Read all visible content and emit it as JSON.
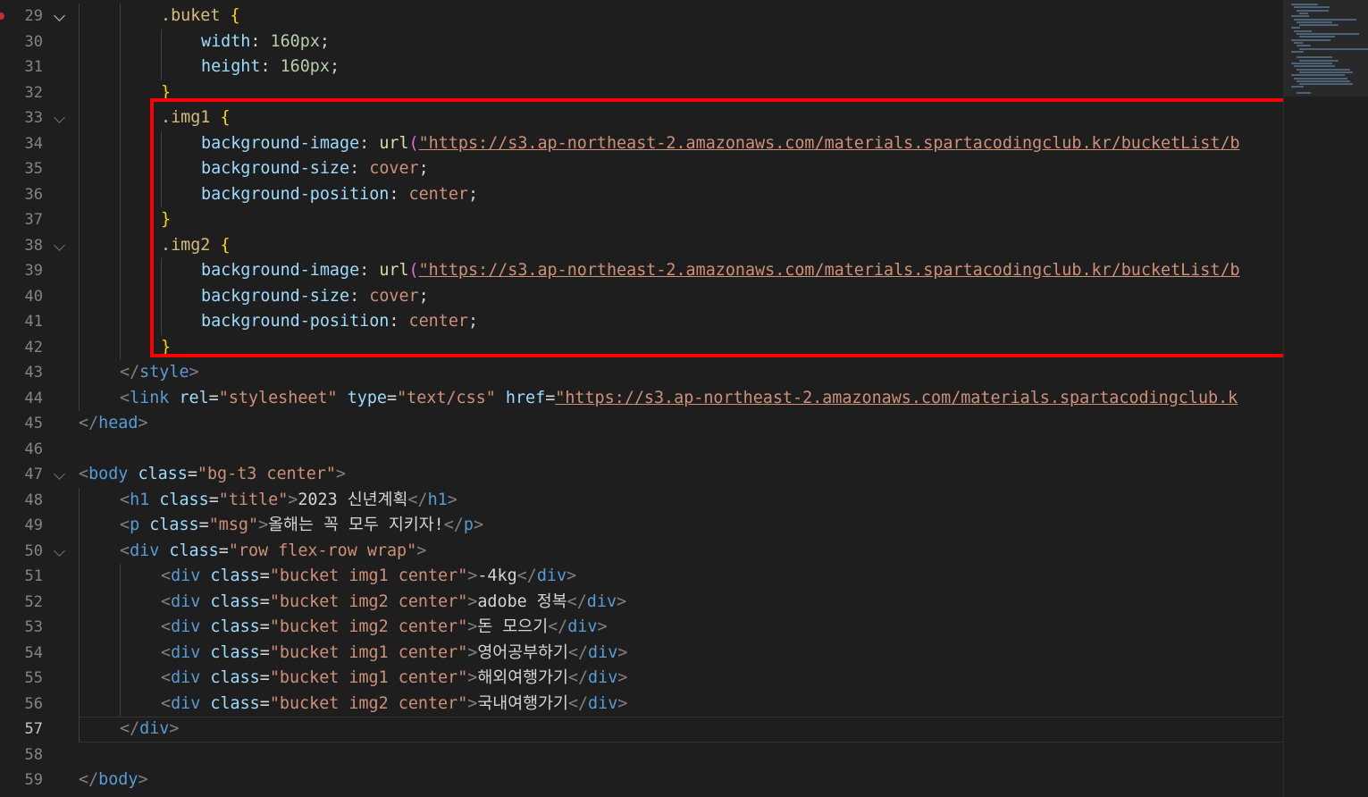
{
  "editor": {
    "current_line": 57,
    "lines": [
      {
        "num": "29",
        "tokens": [
          [
            "t-sel",
            ".buket "
          ],
          [
            "t-br",
            "{"
          ]
        ]
      },
      {
        "num": "30",
        "tokens": [
          [
            "t-prop",
            "width"
          ],
          [
            "t-punc",
            ": "
          ],
          [
            "t-num",
            "160px"
          ],
          [
            "t-punc",
            ";"
          ]
        ]
      },
      {
        "num": "31",
        "tokens": [
          [
            "t-prop",
            "height"
          ],
          [
            "t-punc",
            ": "
          ],
          [
            "t-num",
            "160px"
          ],
          [
            "t-punc",
            ";"
          ]
        ]
      },
      {
        "num": "32",
        "tokens": [
          [
            "t-br",
            "}"
          ]
        ]
      },
      {
        "num": "33",
        "tokens": [
          [
            "t-sel",
            ".img1 "
          ],
          [
            "t-br",
            "{"
          ]
        ]
      },
      {
        "num": "34",
        "tokens": [
          [
            "t-prop",
            "background-image"
          ],
          [
            "t-punc",
            ": "
          ],
          [
            "t-fn",
            "url"
          ],
          [
            "t-br2",
            "("
          ],
          [
            "t-url",
            "\"https://s3.ap-northeast-2.amazonaws.com/materials.spartacodingclub.kr/bucketList/b"
          ]
        ]
      },
      {
        "num": "35",
        "tokens": [
          [
            "t-prop",
            "background-size"
          ],
          [
            "t-punc",
            ": "
          ],
          [
            "t-val",
            "cover"
          ],
          [
            "t-punc",
            ";"
          ]
        ]
      },
      {
        "num": "36",
        "tokens": [
          [
            "t-prop",
            "background-position"
          ],
          [
            "t-punc",
            ": "
          ],
          [
            "t-val",
            "center"
          ],
          [
            "t-punc",
            ";"
          ]
        ]
      },
      {
        "num": "37",
        "tokens": [
          [
            "t-br",
            "}"
          ]
        ]
      },
      {
        "num": "38",
        "tokens": [
          [
            "t-sel",
            ".img2 "
          ],
          [
            "t-br",
            "{"
          ]
        ]
      },
      {
        "num": "39",
        "tokens": [
          [
            "t-prop",
            "background-image"
          ],
          [
            "t-punc",
            ": "
          ],
          [
            "t-fn",
            "url"
          ],
          [
            "t-br2",
            "("
          ],
          [
            "t-url",
            "\"https://s3.ap-northeast-2.amazonaws.com/materials.spartacodingclub.kr/bucketList/b"
          ]
        ]
      },
      {
        "num": "40",
        "tokens": [
          [
            "t-prop",
            "background-size"
          ],
          [
            "t-punc",
            ": "
          ],
          [
            "t-val",
            "cover"
          ],
          [
            "t-punc",
            ";"
          ]
        ]
      },
      {
        "num": "41",
        "tokens": [
          [
            "t-prop",
            "background-position"
          ],
          [
            "t-punc",
            ": "
          ],
          [
            "t-val",
            "center"
          ],
          [
            "t-punc",
            ";"
          ]
        ]
      },
      {
        "num": "42",
        "tokens": [
          [
            "t-br",
            "}"
          ]
        ]
      },
      {
        "num": "43",
        "tokens": [
          [
            "t-tagp",
            "</"
          ],
          [
            "t-tag",
            "style"
          ],
          [
            "t-tagp",
            ">"
          ]
        ]
      },
      {
        "num": "44",
        "tokens": [
          [
            "t-tagp",
            "<"
          ],
          [
            "t-tag",
            "link"
          ],
          [
            "t-punc",
            " "
          ],
          [
            "t-attr",
            "rel"
          ],
          [
            "t-punc",
            "="
          ],
          [
            "t-str",
            "\"stylesheet\""
          ],
          [
            "t-punc",
            " "
          ],
          [
            "t-attr",
            "type"
          ],
          [
            "t-punc",
            "="
          ],
          [
            "t-str",
            "\"text/css\""
          ],
          [
            "t-punc",
            " "
          ],
          [
            "t-attr",
            "href"
          ],
          [
            "t-punc",
            "="
          ],
          [
            "t-url",
            "\"https://s3.ap-northeast-2.amazonaws.com/materials.spartacodingclub.k"
          ]
        ]
      },
      {
        "num": "45",
        "tokens": [
          [
            "t-tagp",
            "</"
          ],
          [
            "t-tag",
            "head"
          ],
          [
            "t-tagp",
            ">"
          ]
        ]
      },
      {
        "num": "46",
        "tokens": []
      },
      {
        "num": "47",
        "tokens": [
          [
            "t-tagp",
            "<"
          ],
          [
            "t-tag",
            "body"
          ],
          [
            "t-punc",
            " "
          ],
          [
            "t-attr",
            "class"
          ],
          [
            "t-punc",
            "="
          ],
          [
            "t-str",
            "\"bg-t3 center\""
          ],
          [
            "t-tagp",
            ">"
          ]
        ]
      },
      {
        "num": "48",
        "tokens": [
          [
            "t-tagp",
            "<"
          ],
          [
            "t-tag",
            "h1"
          ],
          [
            "t-punc",
            " "
          ],
          [
            "t-attr",
            "class"
          ],
          [
            "t-punc",
            "="
          ],
          [
            "t-str",
            "\"title\""
          ],
          [
            "t-tagp",
            ">"
          ],
          [
            "t-txt",
            "2023 신년계획"
          ],
          [
            "t-tagp",
            "</"
          ],
          [
            "t-tag",
            "h1"
          ],
          [
            "t-tagp",
            ">"
          ]
        ]
      },
      {
        "num": "49",
        "tokens": [
          [
            "t-tagp",
            "<"
          ],
          [
            "t-tag",
            "p"
          ],
          [
            "t-punc",
            " "
          ],
          [
            "t-attr",
            "class"
          ],
          [
            "t-punc",
            "="
          ],
          [
            "t-str",
            "\"msg\""
          ],
          [
            "t-tagp",
            ">"
          ],
          [
            "t-txt",
            "올해는 꼭 모두 지키자!"
          ],
          [
            "t-tagp",
            "</"
          ],
          [
            "t-tag",
            "p"
          ],
          [
            "t-tagp",
            ">"
          ]
        ]
      },
      {
        "num": "50",
        "tokens": [
          [
            "t-tagp",
            "<"
          ],
          [
            "t-tag",
            "div"
          ],
          [
            "t-punc",
            " "
          ],
          [
            "t-attr",
            "class"
          ],
          [
            "t-punc",
            "="
          ],
          [
            "t-str",
            "\"row flex-row wrap\""
          ],
          [
            "t-tagp",
            ">"
          ]
        ]
      },
      {
        "num": "51",
        "tokens": [
          [
            "t-tagp",
            "<"
          ],
          [
            "t-tag",
            "div"
          ],
          [
            "t-punc",
            " "
          ],
          [
            "t-attr",
            "class"
          ],
          [
            "t-punc",
            "="
          ],
          [
            "t-str",
            "\"bucket img1 center\""
          ],
          [
            "t-tagp",
            ">"
          ],
          [
            "t-txt",
            "-4kg"
          ],
          [
            "t-tagp",
            "</"
          ],
          [
            "t-tag",
            "div"
          ],
          [
            "t-tagp",
            ">"
          ]
        ]
      },
      {
        "num": "52",
        "tokens": [
          [
            "t-tagp",
            "<"
          ],
          [
            "t-tag",
            "div"
          ],
          [
            "t-punc",
            " "
          ],
          [
            "t-attr",
            "class"
          ],
          [
            "t-punc",
            "="
          ],
          [
            "t-str",
            "\"bucket img2 center\""
          ],
          [
            "t-tagp",
            ">"
          ],
          [
            "t-txt",
            "adobe 정복"
          ],
          [
            "t-tagp",
            "</"
          ],
          [
            "t-tag",
            "div"
          ],
          [
            "t-tagp",
            ">"
          ]
        ]
      },
      {
        "num": "53",
        "tokens": [
          [
            "t-tagp",
            "<"
          ],
          [
            "t-tag",
            "div"
          ],
          [
            "t-punc",
            " "
          ],
          [
            "t-attr",
            "class"
          ],
          [
            "t-punc",
            "="
          ],
          [
            "t-str",
            "\"bucket img2 center\""
          ],
          [
            "t-tagp",
            ">"
          ],
          [
            "t-txt",
            "돈 모으기"
          ],
          [
            "t-tagp",
            "</"
          ],
          [
            "t-tag",
            "div"
          ],
          [
            "t-tagp",
            ">"
          ]
        ]
      },
      {
        "num": "54",
        "tokens": [
          [
            "t-tagp",
            "<"
          ],
          [
            "t-tag",
            "div"
          ],
          [
            "t-punc",
            " "
          ],
          [
            "t-attr",
            "class"
          ],
          [
            "t-punc",
            "="
          ],
          [
            "t-str",
            "\"bucket img1 center\""
          ],
          [
            "t-tagp",
            ">"
          ],
          [
            "t-txt",
            "영어공부하기"
          ],
          [
            "t-tagp",
            "</"
          ],
          [
            "t-tag",
            "div"
          ],
          [
            "t-tagp",
            ">"
          ]
        ]
      },
      {
        "num": "55",
        "tokens": [
          [
            "t-tagp",
            "<"
          ],
          [
            "t-tag",
            "div"
          ],
          [
            "t-punc",
            " "
          ],
          [
            "t-attr",
            "class"
          ],
          [
            "t-punc",
            "="
          ],
          [
            "t-str",
            "\"bucket img1 center\""
          ],
          [
            "t-tagp",
            ">"
          ],
          [
            "t-txt",
            "해외여행가기"
          ],
          [
            "t-tagp",
            "</"
          ],
          [
            "t-tag",
            "div"
          ],
          [
            "t-tagp",
            ">"
          ]
        ]
      },
      {
        "num": "56",
        "tokens": [
          [
            "t-tagp",
            "<"
          ],
          [
            "t-tag",
            "div"
          ],
          [
            "t-punc",
            " "
          ],
          [
            "t-attr",
            "class"
          ],
          [
            "t-punc",
            "="
          ],
          [
            "t-str",
            "\"bucket img2 center\""
          ],
          [
            "t-tagp",
            ">"
          ],
          [
            "t-txt",
            "국내여행가기"
          ],
          [
            "t-tagp",
            "</"
          ],
          [
            "t-tag",
            "div"
          ],
          [
            "t-tagp",
            ">"
          ]
        ]
      },
      {
        "num": "57",
        "tokens": [
          [
            "t-tagp",
            "</"
          ],
          [
            "t-tag",
            "div"
          ],
          [
            "t-tagp",
            ">"
          ]
        ]
      },
      {
        "num": "58",
        "tokens": []
      },
      {
        "num": "59",
        "tokens": [
          [
            "t-tagp",
            "</"
          ],
          [
            "t-tag",
            "body"
          ],
          [
            "t-tagp",
            ">"
          ]
        ]
      }
    ]
  },
  "colors": {
    "background": "#1e1e1e",
    "highlight_box": "#ff0000",
    "breakpoint": "#c72e2e"
  },
  "icons": [
    "chevron-down-icon",
    "breakpoint-dot-icon"
  ]
}
